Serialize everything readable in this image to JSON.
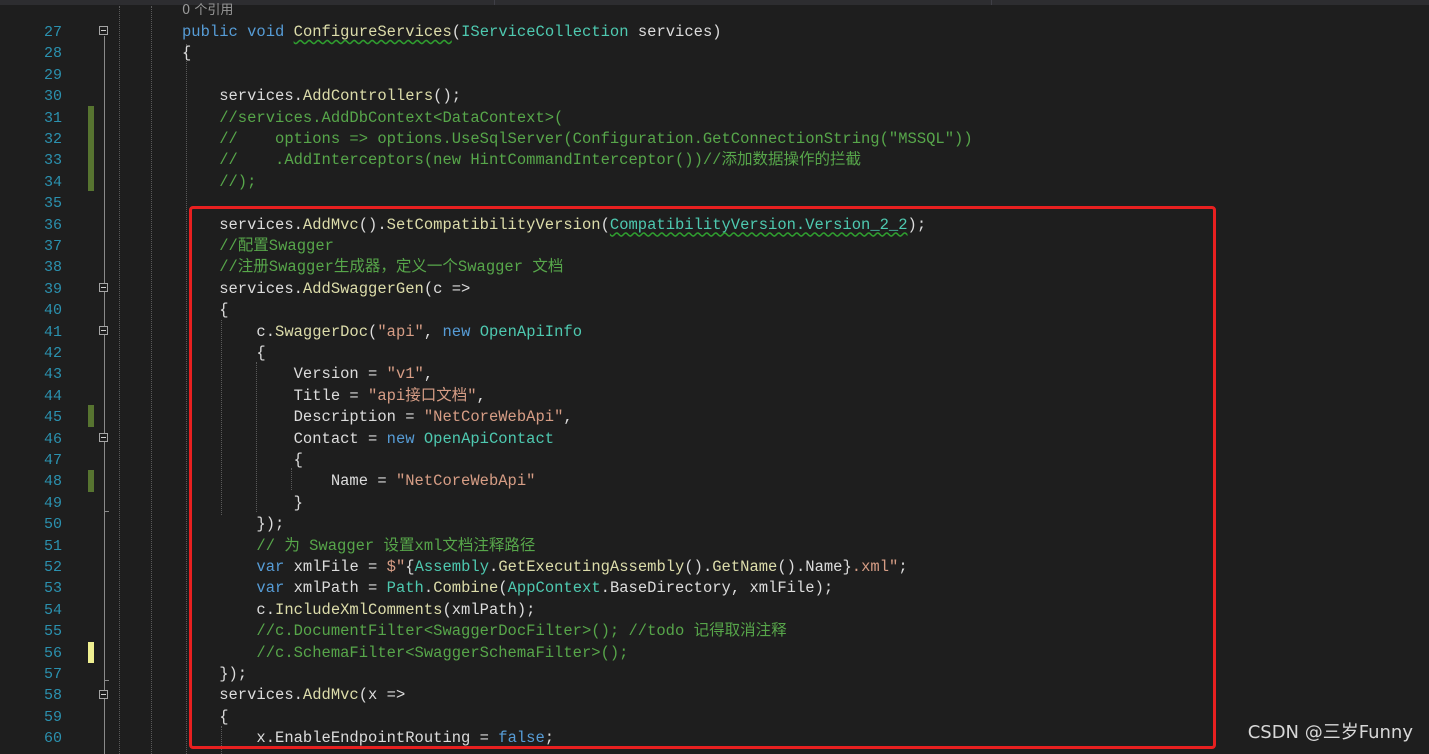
{
  "editor": {
    "codelens": "0 个引用",
    "lines": [
      {
        "n": "27",
        "tokens": [
          {
            "t": "public",
            "c": "kw"
          },
          {
            "t": " "
          },
          {
            "t": "void",
            "c": "kw"
          },
          {
            "t": " "
          },
          {
            "t": "ConfigureServices",
            "c": "mt sq"
          },
          {
            "t": "("
          },
          {
            "t": "IServiceCollection",
            "c": "ty"
          },
          {
            "t": " services)"
          }
        ]
      },
      {
        "n": "28",
        "tokens": [
          {
            "t": "{"
          }
        ]
      },
      {
        "n": "29",
        "tokens": []
      },
      {
        "n": "30",
        "tokens": [
          {
            "t": "    services."
          },
          {
            "t": "AddControllers",
            "c": "mt"
          },
          {
            "t": "();"
          }
        ]
      },
      {
        "n": "31",
        "tokens": [
          {
            "t": "    //services.AddDbContext<DataContext>(",
            "c": "cm"
          }
        ]
      },
      {
        "n": "32",
        "tokens": [
          {
            "t": "    //    options => options.UseSqlServer(Configuration.GetConnectionString(\"MSSQL\"))",
            "c": "cm"
          }
        ]
      },
      {
        "n": "33",
        "tokens": [
          {
            "t": "    //    .AddInterceptors(new HintCommandInterceptor())//添加数据操作的拦截",
            "c": "cm"
          }
        ]
      },
      {
        "n": "34",
        "tokens": [
          {
            "t": "    //);",
            "c": "cm"
          }
        ]
      },
      {
        "n": "35",
        "tokens": []
      },
      {
        "n": "36",
        "tokens": [
          {
            "t": "    services."
          },
          {
            "t": "AddMvc",
            "c": "mt"
          },
          {
            "t": "()."
          },
          {
            "t": "SetCompatibilityVersion",
            "c": "mt"
          },
          {
            "t": "("
          },
          {
            "t": "CompatibilityVersion.Version_2_2",
            "c": "ty sq"
          },
          {
            "t": ");"
          }
        ]
      },
      {
        "n": "37",
        "tokens": [
          {
            "t": "    //配置Swagger",
            "c": "cm"
          }
        ]
      },
      {
        "n": "38",
        "tokens": [
          {
            "t": "    //注册Swagger生成器，定义一个Swagger 文档",
            "c": "cm"
          }
        ]
      },
      {
        "n": "39",
        "tokens": [
          {
            "t": "    services."
          },
          {
            "t": "AddSwaggerGen",
            "c": "mt"
          },
          {
            "t": "(c =>"
          }
        ]
      },
      {
        "n": "40",
        "tokens": [
          {
            "t": "    {"
          }
        ]
      },
      {
        "n": "41",
        "tokens": [
          {
            "t": "        c."
          },
          {
            "t": "SwaggerDoc",
            "c": "mt"
          },
          {
            "t": "("
          },
          {
            "t": "\"api\"",
            "c": "st"
          },
          {
            "t": ", "
          },
          {
            "t": "new",
            "c": "kw"
          },
          {
            "t": " "
          },
          {
            "t": "OpenApiInfo",
            "c": "ty"
          }
        ]
      },
      {
        "n": "42",
        "tokens": [
          {
            "t": "        {"
          }
        ]
      },
      {
        "n": "43",
        "tokens": [
          {
            "t": "            Version = "
          },
          {
            "t": "\"v1\"",
            "c": "st"
          },
          {
            "t": ","
          }
        ]
      },
      {
        "n": "44",
        "tokens": [
          {
            "t": "            Title = "
          },
          {
            "t": "\"api接口文档\"",
            "c": "st"
          },
          {
            "t": ","
          }
        ]
      },
      {
        "n": "45",
        "tokens": [
          {
            "t": "            Description = "
          },
          {
            "t": "\"NetCoreWebApi\"",
            "c": "st"
          },
          {
            "t": ","
          }
        ]
      },
      {
        "n": "46",
        "tokens": [
          {
            "t": "            Contact = "
          },
          {
            "t": "new",
            "c": "kw"
          },
          {
            "t": " "
          },
          {
            "t": "OpenApiContact",
            "c": "ty"
          }
        ]
      },
      {
        "n": "47",
        "tokens": [
          {
            "t": "            {"
          }
        ]
      },
      {
        "n": "48",
        "tokens": [
          {
            "t": "                Name = "
          },
          {
            "t": "\"NetCoreWebApi\"",
            "c": "st"
          }
        ]
      },
      {
        "n": "49",
        "tokens": [
          {
            "t": "            }"
          }
        ]
      },
      {
        "n": "50",
        "tokens": [
          {
            "t": "        });"
          }
        ]
      },
      {
        "n": "51",
        "tokens": [
          {
            "t": "        // 为 Swagger 设置xml文档注释路径",
            "c": "cm"
          }
        ]
      },
      {
        "n": "52",
        "tokens": [
          {
            "t": "        "
          },
          {
            "t": "var",
            "c": "kw"
          },
          {
            "t": " xmlFile = "
          },
          {
            "t": "$\"",
            "c": "st"
          },
          {
            "t": "{"
          },
          {
            "t": "Assembly",
            "c": "ty"
          },
          {
            "t": "."
          },
          {
            "t": "GetExecutingAssembly",
            "c": "mt"
          },
          {
            "t": "()."
          },
          {
            "t": "GetName",
            "c": "mt"
          },
          {
            "t": "().Name}"
          },
          {
            "t": ".xml\"",
            "c": "st"
          },
          {
            "t": ";"
          }
        ]
      },
      {
        "n": "53",
        "tokens": [
          {
            "t": "        "
          },
          {
            "t": "var",
            "c": "kw"
          },
          {
            "t": " xmlPath = "
          },
          {
            "t": "Path",
            "c": "ty"
          },
          {
            "t": "."
          },
          {
            "t": "Combine",
            "c": "mt"
          },
          {
            "t": "("
          },
          {
            "t": "AppContext",
            "c": "ty"
          },
          {
            "t": ".BaseDirectory, xmlFile);"
          }
        ]
      },
      {
        "n": "54",
        "tokens": [
          {
            "t": "        c."
          },
          {
            "t": "IncludeXmlComments",
            "c": "mt"
          },
          {
            "t": "(xmlPath);"
          }
        ]
      },
      {
        "n": "55",
        "tokens": [
          {
            "t": "        //c.DocumentFilter<SwaggerDocFilter>(); //todo 记得取消注释",
            "c": "cm"
          }
        ]
      },
      {
        "n": "56",
        "tokens": [
          {
            "t": "        //c.SchemaFilter<SwaggerSchemaFilter>();",
            "c": "cm"
          }
        ]
      },
      {
        "n": "57",
        "tokens": [
          {
            "t": "    });"
          }
        ]
      },
      {
        "n": "58",
        "tokens": [
          {
            "t": "    services."
          },
          {
            "t": "AddMvc",
            "c": "mt"
          },
          {
            "t": "(x =>"
          }
        ]
      },
      {
        "n": "59",
        "tokens": [
          {
            "t": "    {"
          }
        ]
      },
      {
        "n": "60",
        "tokens": [
          {
            "t": "        x.EnableEndpointRouting = "
          },
          {
            "t": "false",
            "c": "kw"
          },
          {
            "t": ";"
          }
        ]
      }
    ]
  },
  "watermark": "CSDN @三岁Funny",
  "colors": {
    "background": "#1e1e1e",
    "line_number": "#2b91af",
    "keyword": "#569cd6",
    "type": "#4ec9b0",
    "method": "#dcdcaa",
    "string": "#d69d85",
    "comment": "#57a64a",
    "highlight_box": "#e82020"
  },
  "icons": [
    "collapse-icon"
  ]
}
